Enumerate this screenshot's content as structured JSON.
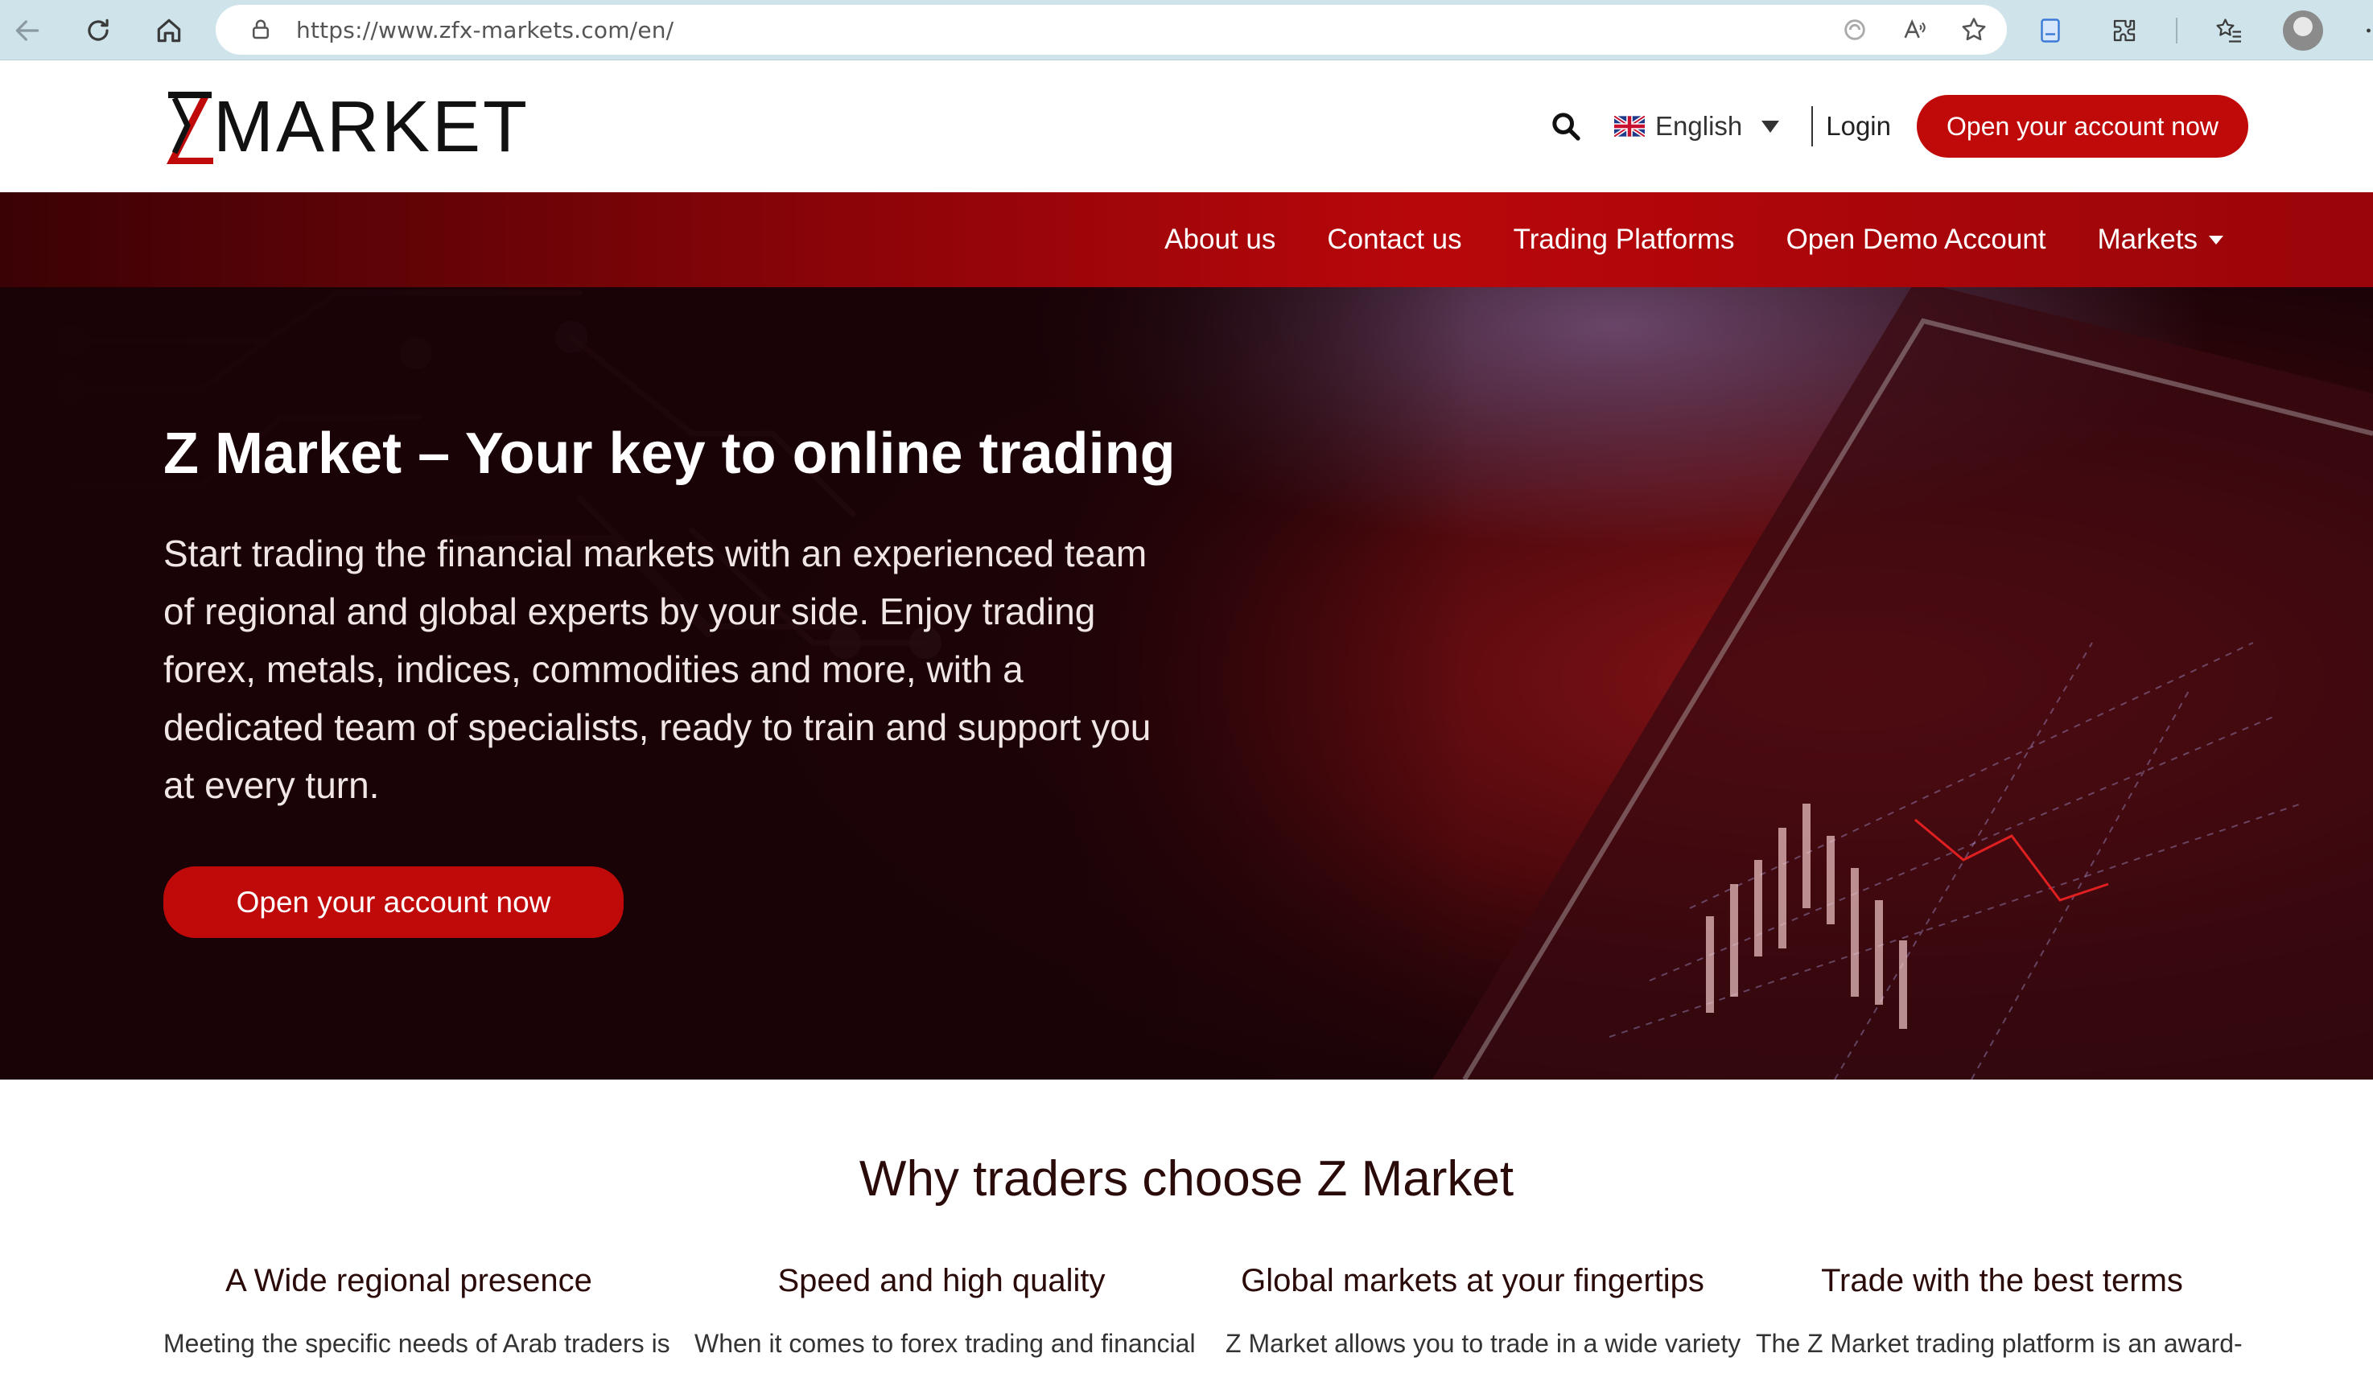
{
  "browser": {
    "url": "https://www.zfx-markets.com/en/"
  },
  "header": {
    "logo_text": "MARKET",
    "language": "English",
    "login": "Login",
    "cta": "Open your account now"
  },
  "nav": {
    "items": [
      "About us",
      "Contact us",
      "Trading Platforms",
      "Open Demo Account",
      "Markets"
    ]
  },
  "hero": {
    "title": "Z Market – Your key to online trading",
    "body": "Start trading the financial markets with an experienced team of regional and global experts by your side. Enjoy trading forex, metals, indices, commodities and more, with a dedicated team of specialists, ready to train and support you at every turn.",
    "cta": "Open your account now"
  },
  "why": {
    "title": "Why traders choose Z Market",
    "features": [
      {
        "title": "A Wide regional presence",
        "text": "Meeting the specific needs of Arab traders is"
      },
      {
        "title": "Speed and high quality",
        "text": "When it comes to forex trading and financial"
      },
      {
        "title": "Global markets at your fingertips",
        "text": "Z Market allows you to trade in a wide variety"
      },
      {
        "title": "Trade with the best terms",
        "text": "The Z Market trading platform is an award-"
      }
    ]
  },
  "colors": {
    "brand_red": "#c00a0a",
    "hero_dark": "#1a0307",
    "heading_dark": "#2b0a0a"
  }
}
